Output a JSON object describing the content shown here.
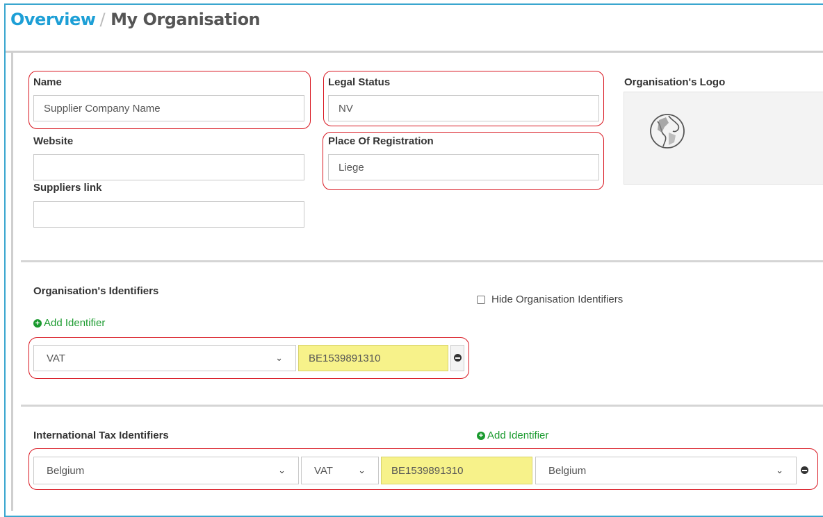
{
  "breadcrumb": {
    "root": "Overview",
    "separator": "/",
    "current": "My Organisation"
  },
  "org": {
    "name_label": "Name",
    "name_value": "Supplier Company Name",
    "legal_status_label": "Legal Status",
    "legal_status_value": "NV",
    "website_label": "Website",
    "website_value": "",
    "place_label": "Place Of Registration",
    "place_value": "Liege",
    "suppliers_link_label": "Suppliers link",
    "suppliers_link_value": "",
    "logo_label": "Organisation's Logo"
  },
  "identifiers": {
    "title": "Organisation's Identifiers",
    "hide_label": "Hide Organisation Identifiers",
    "hide_checked": false,
    "add_label": "Add Identifier",
    "type_value": "VAT",
    "id_value": "BE1539891310"
  },
  "tax": {
    "title": "International Tax Identifiers",
    "add_label": "Add Identifier",
    "country_value": "Belgium",
    "type_value": "VAT",
    "id_value": "BE1539891310",
    "issuer_country_value": "Belgium"
  },
  "colors": {
    "accent": "#1d9fd6",
    "highlight": "#f7f28a",
    "add_green": "#1a9a2e",
    "annotation_red": "#d8141e"
  }
}
